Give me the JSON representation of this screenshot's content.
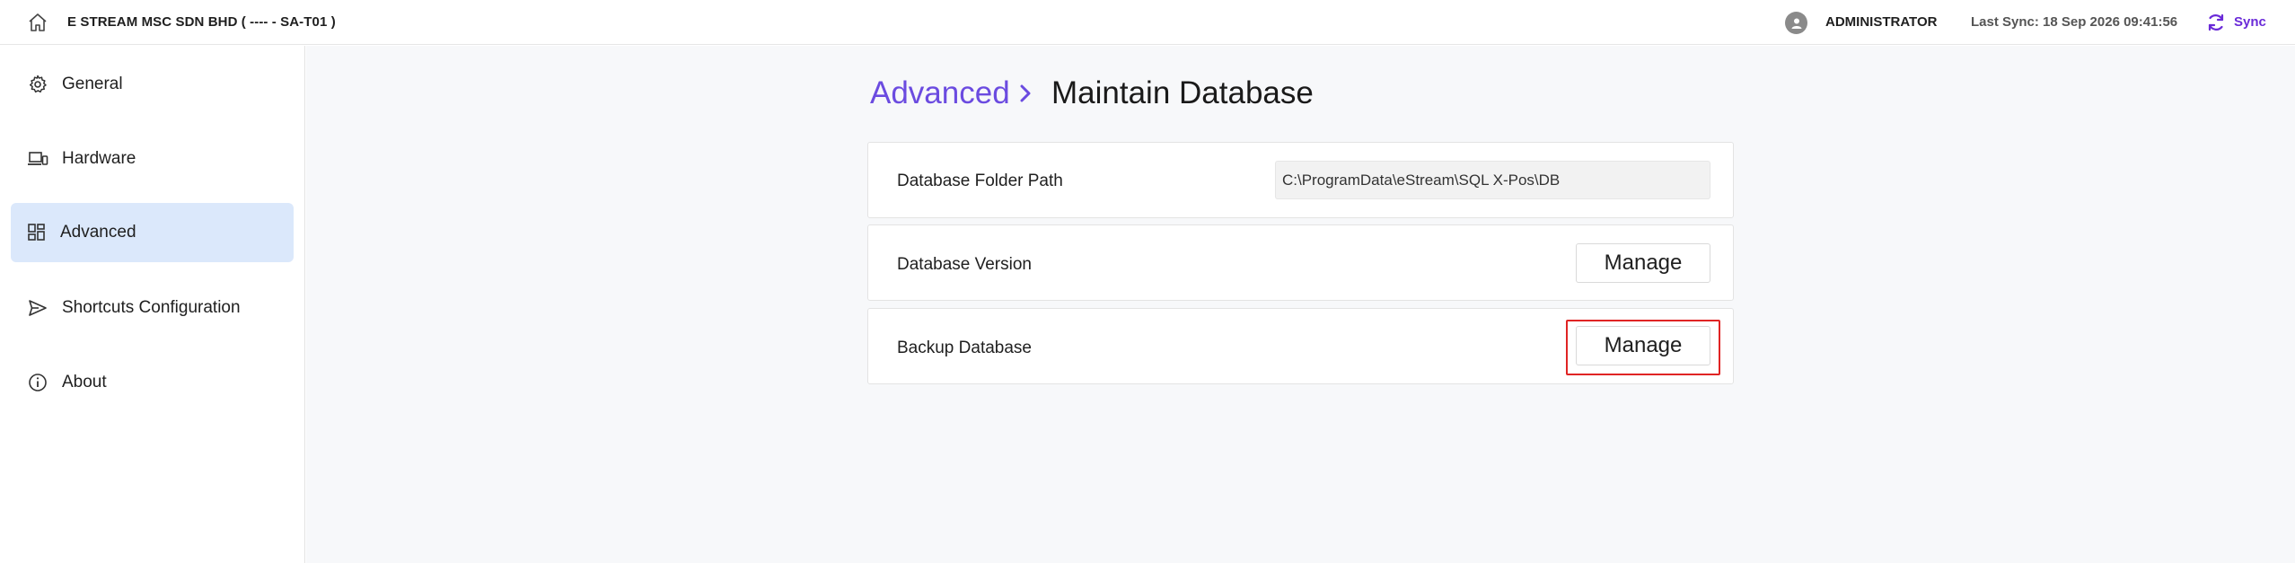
{
  "header": {
    "company": "E STREAM MSC SDN BHD ( ---- - SA-T01 )",
    "user": "ADMINISTRATOR",
    "last_sync": "Last Sync: 18 Sep 2026 09:41:56",
    "sync_label": "Sync",
    "accent": "#6a2ad8"
  },
  "sidebar": {
    "items": [
      {
        "label": "General",
        "icon": "gear-icon"
      },
      {
        "label": "Hardware",
        "icon": "devices-icon"
      },
      {
        "label": "Advanced",
        "icon": "dashboard-icon",
        "active": true
      },
      {
        "label": "Shortcuts Configuration",
        "icon": "send-icon"
      },
      {
        "label": "About",
        "icon": "info-icon"
      }
    ],
    "active_bg": "#dbe8fb"
  },
  "breadcrumb": {
    "parent": "Advanced",
    "current": "Maintain Database",
    "parent_color": "#6b4be0"
  },
  "settings": {
    "folder_path_label": "Database Folder Path",
    "folder_path_value": "C:\\ProgramData\\eStream\\SQL X-Pos\\DB",
    "version_label": "Database Version",
    "version_button": "Manage",
    "backup_label": "Backup Database",
    "backup_button": "Manage"
  }
}
